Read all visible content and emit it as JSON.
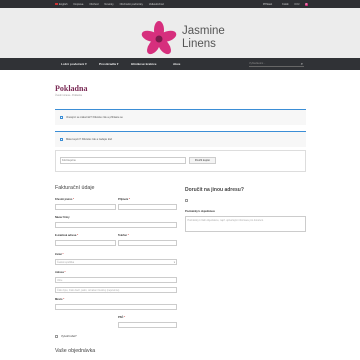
{
  "topbar": {
    "links": [
      "English",
      "Doprava",
      "Obchod",
      "Novinky",
      "Obchodní podmínky",
      "Velkoobchod"
    ],
    "account": "Přihlásit",
    "cart_label": "Košík",
    "cart_total": "0 Kč",
    "cart_count": "0"
  },
  "brand": {
    "name_line1": "Jasmine",
    "name_line2": "Linens",
    "colors": {
      "petal": "#d62f7d",
      "center": "#7a1d4c"
    }
  },
  "nav": {
    "items": [
      "Ložní povlečení",
      "Prostěradla",
      "Hliníkové krabice",
      "Akce"
    ],
    "search_placeholder": "Vyhledávání..."
  },
  "page": {
    "title": "Pokladna",
    "breadcrumb": "Úvodní strana › Pokladna"
  },
  "notices": {
    "returning_customer": "Vracející se zákazník? Klikněte zde a přihlaste se",
    "coupon": "Máte kupón? Klikněte zde a zadejte kód"
  },
  "coupon_form": {
    "placeholder": "Kód kupónu",
    "button": "Použít kupón"
  },
  "billing": {
    "title": "Fakturační údaje",
    "first_name": "Křestní jméno",
    "last_name": "Příjmení",
    "company": "Název firmy",
    "email": "E-mailová adresa",
    "phone": "Telefon",
    "country_label": "Země",
    "country_value": "Česká republika",
    "address_label": "Adresa",
    "address_placeholder": "Ulice",
    "address2_placeholder": "Číslo bytu, číslo dveří, patro, označení budovy (nepovinné)",
    "city": "Město",
    "zip": "PSČ",
    "create_account": "Vytvořit účet?"
  },
  "shipping": {
    "title": "Doručit na jinou adresu?",
    "notes_label": "Poznámky k objednávce",
    "notes_placeholder": "Poznámky k Vaší objednávce, např. upřesňující informace pro doručení."
  },
  "order": {
    "title": "Vaše objednávka"
  }
}
